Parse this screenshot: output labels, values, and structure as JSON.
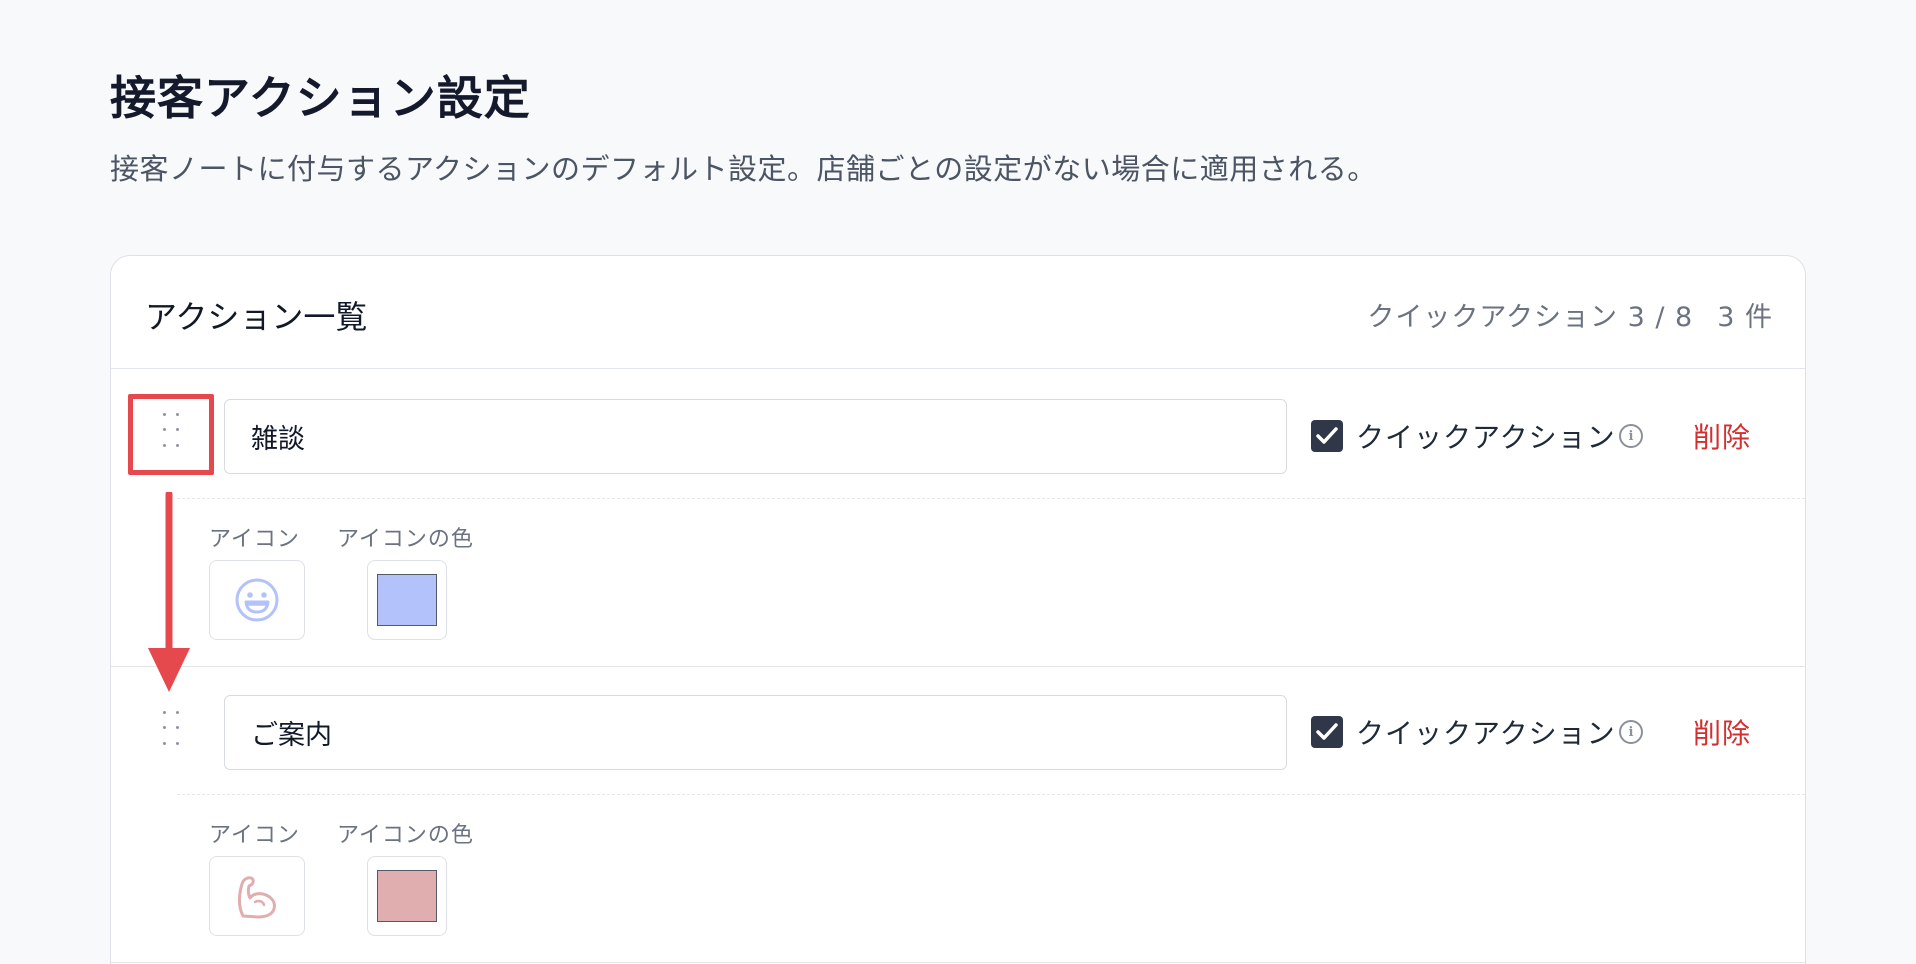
{
  "page": {
    "title": "接客アクション設定",
    "description": "接客ノートに付与するアクションのデフォルト設定。店舗ごとの設定がない場合に適用される。"
  },
  "card": {
    "title": "アクション一覧",
    "quick_action_count": "クイックアクション 3 / 8",
    "total_count": "3 件"
  },
  "actions": [
    {
      "name": "雑談",
      "quick_action_checked": true,
      "quick_action_label": "クイックアクション",
      "delete_label": "削除",
      "icon_label": "アイコン",
      "icon_color_label": "アイコンの色",
      "icon": "grinning-face-icon",
      "color": "#b3c2fb"
    },
    {
      "name": "ご案内",
      "quick_action_checked": true,
      "quick_action_label": "クイックアクション",
      "delete_label": "削除",
      "icon_label": "アイコン",
      "icon_color_label": "アイコンの色",
      "icon": "flexed-biceps-icon",
      "color": "#e0aeaf"
    }
  ],
  "annotation": {
    "highlight_color": "#e5484d"
  }
}
